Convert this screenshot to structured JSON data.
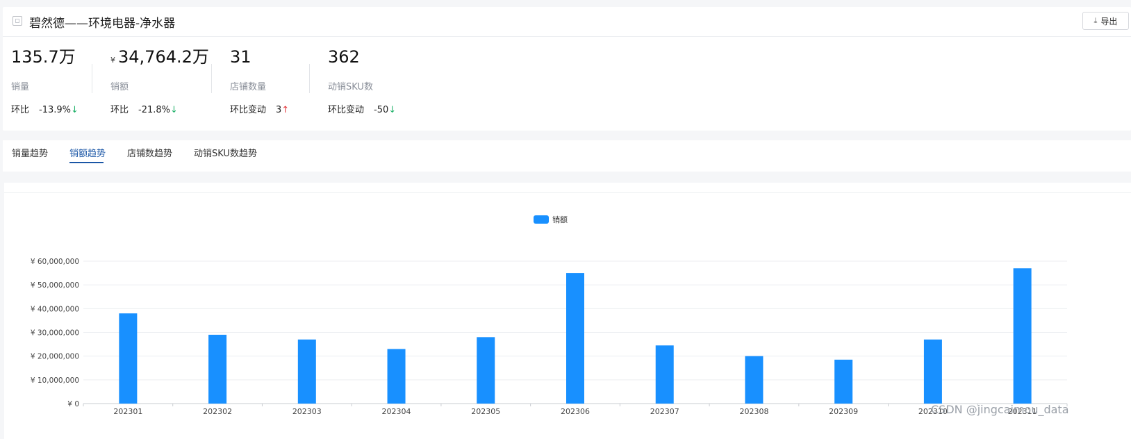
{
  "header": {
    "title": "碧然德——环境电器-净水器",
    "export_label": "导出",
    "export_icon": "download-icon"
  },
  "metrics": [
    {
      "value": "135.7万",
      "currency": "",
      "label": "销量",
      "cmp_label": "环比",
      "cmp_value": "-13.9%",
      "dir": "down"
    },
    {
      "value": "34,764.2万",
      "currency": "¥",
      "label": "销额",
      "cmp_label": "环比",
      "cmp_value": "-21.8%",
      "dir": "down"
    },
    {
      "value": "31",
      "currency": "",
      "label": "店铺数量",
      "cmp_label": "环比变动",
      "cmp_value": "3",
      "dir": "up"
    },
    {
      "value": "362",
      "currency": "",
      "label": "动销SKU数",
      "cmp_label": "环比变动",
      "cmp_value": "-50",
      "dir": "down"
    }
  ],
  "arrows": {
    "down": "↓",
    "up": "↑"
  },
  "tabs": [
    "销量趋势",
    "销额趋势",
    "店铺数趋势",
    "动销SKU数趋势"
  ],
  "active_tab": 1,
  "colors": {
    "accent": "#1a56a6",
    "bar": "#1890ff",
    "down": "#22b26b",
    "up": "#e4393c"
  },
  "chart_data": {
    "type": "bar",
    "legend": "销额",
    "legend_position": "top-center",
    "categories": [
      "202301",
      "202302",
      "202303",
      "202304",
      "202305",
      "202306",
      "202307",
      "202308",
      "202309",
      "202310",
      "202311"
    ],
    "series": [
      {
        "name": "销额",
        "values": [
          38000000,
          29000000,
          27000000,
          23000000,
          28000000,
          55000000,
          24500000,
          20000000,
          18500000,
          27000000,
          57000000
        ]
      }
    ],
    "yticks": [
      "¥ 0",
      "¥ 10,000,000",
      "¥ 20,000,000",
      "¥ 30,000,000",
      "¥ 40,000,000",
      "¥ 50,000,000",
      "¥ 60,000,000"
    ],
    "ylim": [
      0,
      60000000
    ],
    "grid": true
  },
  "watermark": "CSDN @jingcaimou_data"
}
